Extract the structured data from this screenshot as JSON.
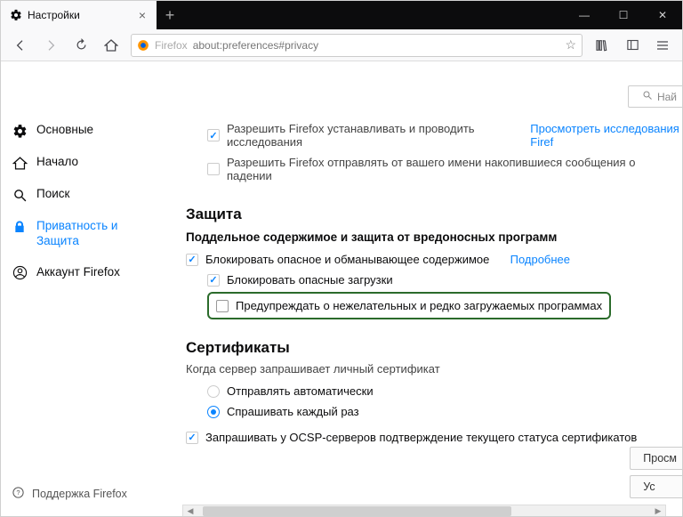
{
  "tab": {
    "title": "Настройки"
  },
  "url": {
    "prefix": "Firefox",
    "address": "about:preferences#privacy"
  },
  "search": {
    "placeholder": "Най"
  },
  "sidebar": {
    "items": [
      {
        "label": "Основные"
      },
      {
        "label": "Начало"
      },
      {
        "label": "Поиск"
      },
      {
        "label": "Приватность и Защита"
      },
      {
        "label": "Аккаунт Firefox"
      }
    ],
    "support": "Поддержка Firefox"
  },
  "research": {
    "allow_label": "Разрешить Firefox устанавливать и проводить исследования",
    "view_link": "Просмотреть исследования Firef",
    "crash_label": "Разрешить Firefox отправлять от вашего имени накопившиеся сообщения о падении"
  },
  "protection": {
    "heading": "Защита",
    "sub": "Поддельное содержимое и защита от вредоносных программ",
    "block_bad": "Блокировать опасное и обманывающее содержимое",
    "learn_more": "Подробнее",
    "block_downloads": "Блокировать опасные загрузки",
    "warn_unwanted": "Предупреждать о нежелательных и редко загружаемых программах"
  },
  "certs": {
    "heading": "Сертификаты",
    "desc": "Когда сервер запрашивает личный сертификат",
    "auto": "Отправлять автоматически",
    "ask": "Спрашивать каждый раз",
    "ocsp": "Запрашивать у OCSP-серверов подтверждение текущего статуса сертификатов"
  },
  "buttons": {
    "view": "Просм",
    "u": "Ус"
  }
}
